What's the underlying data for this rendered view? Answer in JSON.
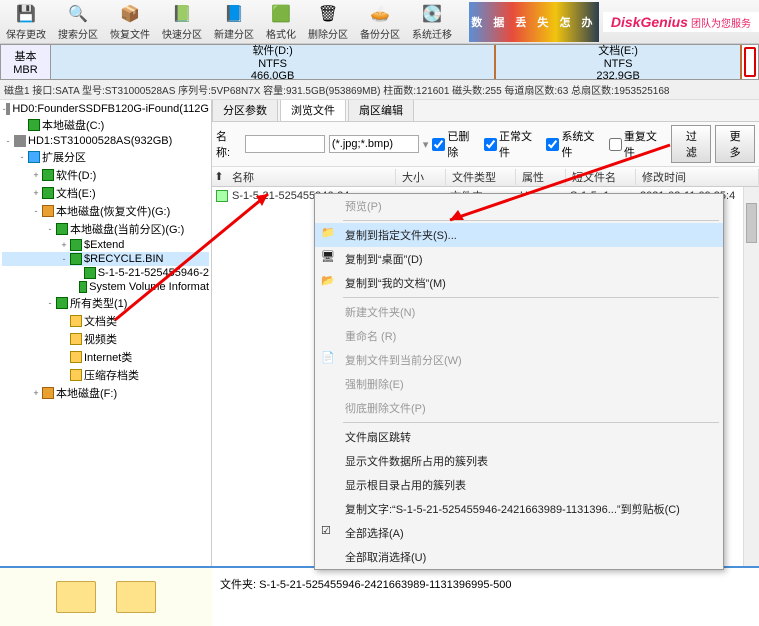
{
  "toolbar": {
    "items": [
      {
        "label": "保存更改",
        "icon": "💾",
        "color": "#d9534f"
      },
      {
        "label": "搜索分区",
        "icon": "🔍",
        "color": "#555"
      },
      {
        "label": "恢复文件",
        "icon": "📦",
        "color": "#8b5a2b"
      },
      {
        "label": "快速分区",
        "icon": "📗",
        "color": "#2e8b57"
      },
      {
        "label": "新建分区",
        "icon": "📘",
        "color": "#1e90ff"
      },
      {
        "label": "格式化",
        "icon": "🟩",
        "color": "#228b22"
      },
      {
        "label": "删除分区",
        "icon": "🗑",
        "color": "#888"
      },
      {
        "label": "备份分区",
        "icon": "🥧",
        "color": "#cc3399"
      },
      {
        "label": "系统迁移",
        "icon": "💽",
        "color": "#4682b4"
      }
    ]
  },
  "banner": {
    "big": "数 据 丢 失 怎 办",
    "brand": "DiskGenius",
    "tag": "团队为您服务"
  },
  "diskbar": {
    "left1": "基本",
    "left2": "MBR",
    "parts": [
      {
        "title": "软件(D:)",
        "fs": "NTFS",
        "size": "466.0GB"
      },
      {
        "title": "文档(E:)",
        "fs": "NTFS",
        "size": "232.9GB"
      }
    ]
  },
  "status": "磁盘1 接口:SATA 型号:ST31000528AS 序列号:5VP68N7X 容量:931.5GB(953869MB) 柱面数:121601 磁头数:255 每道扇区数:63 总扇区数:1953525168",
  "tree": [
    {
      "lvl": 0,
      "exp": "-",
      "ico": "hdd",
      "txt": "HD0:FounderSSDFB120G-iFound(112G"
    },
    {
      "lvl": 1,
      "exp": "",
      "ico": "green",
      "txt": "本地磁盘(C:)"
    },
    {
      "lvl": 0,
      "exp": "-",
      "ico": "hdd",
      "txt": "HD1:ST31000528AS(932GB)"
    },
    {
      "lvl": 1,
      "exp": "-",
      "ico": "blue",
      "txt": "扩展分区"
    },
    {
      "lvl": 2,
      "exp": "+",
      "ico": "green",
      "txt": "软件(D:)"
    },
    {
      "lvl": 2,
      "exp": "+",
      "ico": "green",
      "txt": "文档(E:)"
    },
    {
      "lvl": 2,
      "exp": "-",
      "ico": "orange",
      "txt": "本地磁盘(恢复文件)(G:)"
    },
    {
      "lvl": 3,
      "exp": "-",
      "ico": "green",
      "txt": "本地磁盘(当前分区)(G:)"
    },
    {
      "lvl": 4,
      "exp": "+",
      "ico": "green",
      "txt": "$Extend"
    },
    {
      "lvl": 4,
      "exp": "-",
      "ico": "green",
      "txt": "$RECYCLE.BIN",
      "sel": true
    },
    {
      "lvl": 5,
      "exp": "",
      "ico": "green",
      "txt": "S-1-5-21-525455946-2"
    },
    {
      "lvl": 5,
      "exp": "",
      "ico": "green",
      "txt": "System Volume Informat"
    },
    {
      "lvl": 3,
      "exp": "-",
      "ico": "green",
      "txt": "所有类型(1)"
    },
    {
      "lvl": 4,
      "exp": "",
      "ico": "folder",
      "txt": "文档类"
    },
    {
      "lvl": 4,
      "exp": "",
      "ico": "folder",
      "txt": "视频类"
    },
    {
      "lvl": 4,
      "exp": "",
      "ico": "folder",
      "txt": "Internet类"
    },
    {
      "lvl": 4,
      "exp": "",
      "ico": "folder",
      "txt": "压缩存档类"
    },
    {
      "lvl": 2,
      "exp": "+",
      "ico": "orange",
      "txt": "本地磁盘(F:)"
    }
  ],
  "tabs": [
    "分区参数",
    "浏览文件",
    "扇区编辑"
  ],
  "active_tab": 1,
  "filter": {
    "name_lbl": "名称:",
    "name_val": "",
    "type_val": "(*.jpg;*.bmp)",
    "cb_deleted": "已删除",
    "cb_normal": "正常文件",
    "cb_system": "系统文件",
    "cb_dup": "重复文件",
    "btn_filter": "过滤",
    "btn_more": "更多"
  },
  "cols": {
    "name": "名称",
    "size": "大小",
    "type": "文件类型",
    "attr": "属性",
    "short": "短文件名",
    "mtime": "修改时间"
  },
  "row": {
    "name": "S-1-5-21-525455946-24",
    "type": "文件夹",
    "attr": "HS",
    "short": "S-1-5~1",
    "mtime": "2021-03-11 09:35:4"
  },
  "ctx": [
    {
      "txt": "预览(P)",
      "dis": true
    },
    {
      "sep": true
    },
    {
      "txt": "复制到指定文件夹(S)...",
      "hover": true,
      "ico": "📁"
    },
    {
      "txt": "复制到“桌面”(D)",
      "ico": "🖥"
    },
    {
      "txt": "复制到“我的文档”(M)",
      "ico": "📂"
    },
    {
      "sep": true
    },
    {
      "txt": "新建文件夹(N)",
      "dis": true
    },
    {
      "txt": "重命名 (R)",
      "dis": true
    },
    {
      "txt": "复制文件到当前分区(W)",
      "dis": true,
      "ico": "📄"
    },
    {
      "txt": "强制删除(E)",
      "dis": true
    },
    {
      "txt": "彻底删除文件(P)",
      "dis": true
    },
    {
      "sep": true
    },
    {
      "txt": "文件扇区跳转"
    },
    {
      "txt": "显示文件数据所占用的簇列表"
    },
    {
      "txt": "显示根目录占用的簇列表"
    },
    {
      "txt": "复制文字:“S-1-5-21-525455946-2421663989-1131396...”到剪贴板(C)"
    },
    {
      "txt": "全部选择(A)",
      "ico": "☑"
    },
    {
      "txt": "全部取消选择(U)"
    }
  ],
  "bottom": {
    "info": "文件夹: S-1-5-21-525455946-2421663989-1131396995-500"
  }
}
